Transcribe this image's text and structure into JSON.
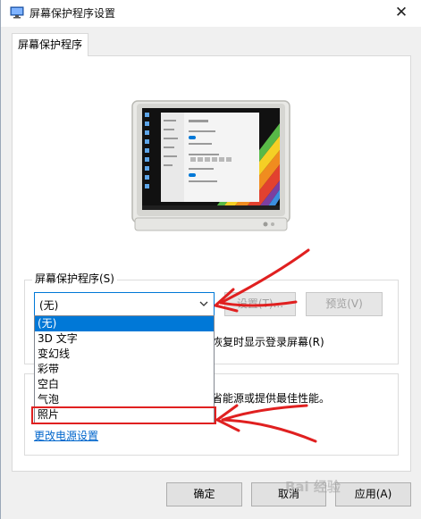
{
  "window": {
    "title": "屏幕保护程序设置",
    "close_glyph": "✕"
  },
  "tabs": [
    {
      "label": "屏幕保护程序"
    }
  ],
  "screensaver": {
    "group_label": "屏幕保护程序(S)",
    "selected": "(无)",
    "settings_label": "设置(T)...",
    "preview_label": "预览(V)",
    "resume_text": "恢复时显示登录屏幕(R)",
    "options": [
      "(无)",
      "3D 文字",
      "变幻线",
      "彩带",
      "空白",
      "气泡",
      "照片"
    ]
  },
  "power": {
    "text": "省能源或提供最佳性能。",
    "link": "更改电源设置"
  },
  "buttons": {
    "ok": "确定",
    "cancel": "取消",
    "apply": "应用(A)"
  },
  "watermark": "Bai 经验",
  "colors": {
    "accent": "#0078d7",
    "annotation": "#e02020",
    "link": "#0066cc"
  },
  "icons": {
    "app": "screensaver-monitor-icon",
    "dropdown": "chevron-down-icon"
  }
}
